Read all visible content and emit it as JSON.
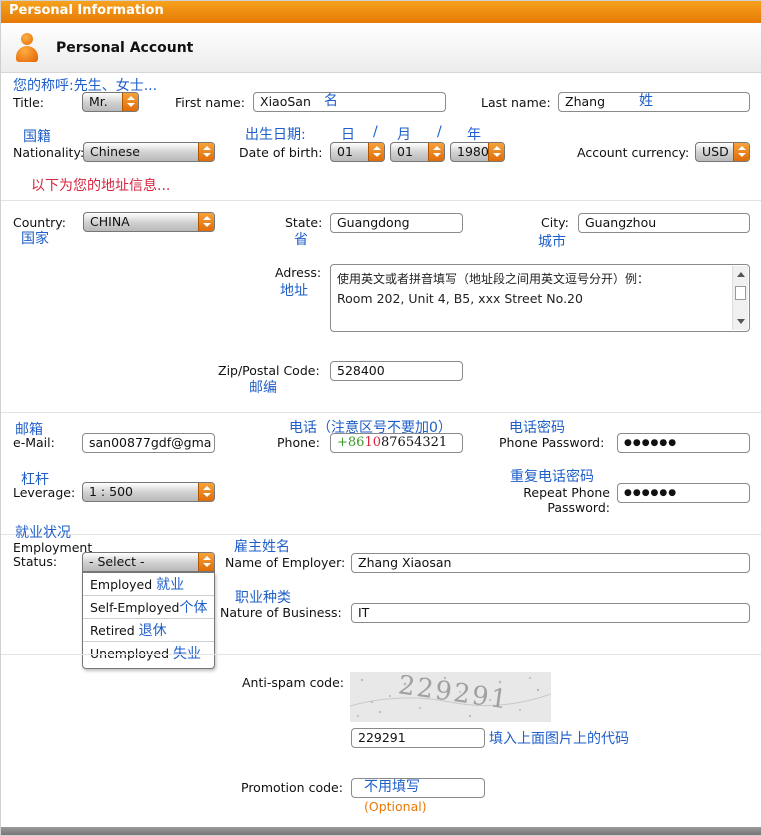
{
  "topbar": {
    "title": "Personal Information"
  },
  "header": {
    "title": "Personal Account",
    "icon": "person-icon"
  },
  "annotations": {
    "salutation": "您的称呼:先生、女士...",
    "first_name_cn": "名",
    "last_name_cn": "姓",
    "nationality_cn": "国籍",
    "dob_cn": "出生日期:",
    "dob_day": "日",
    "dob_month": "月",
    "dob_year": "年",
    "dob_slash1": "/",
    "dob_slash2": "/",
    "address_info": "以下为您的地址信息...",
    "country_cn": "国家",
    "state_cn": "省",
    "city_cn": "城市",
    "address_cn": "地址",
    "zip_cn": "邮编",
    "email_cn": "邮箱",
    "phone_cn": "电话（注意区号不要加0）",
    "phone_pw_cn": "电话密码",
    "leverage_cn": "杠杆",
    "repeat_pw_cn": "重复电话密码",
    "employment_cn": "就业状况",
    "employer_cn": "雇主姓名",
    "business_cn": "职业种类",
    "captcha_cn": "填入上面图片上的代码",
    "promo_cn": "不用填写"
  },
  "form": {
    "title_label": "Title:",
    "title_value": "Mr.",
    "first_name_label": "First name:",
    "first_name_value": "XiaoSan",
    "last_name_label": "Last name:",
    "last_name_value": "Zhang",
    "nationality_label": "Nationality:",
    "nationality_value": "Chinese",
    "dob_label": "Date of birth:",
    "dob_day_value": "01",
    "dob_month_value": "01",
    "dob_year_value": "1980",
    "currency_label": "Account currency:",
    "currency_value": "USD",
    "country_label": "Country:",
    "country_value": "CHINA",
    "state_label": "State:",
    "state_value": "Guangdong",
    "city_label": "City:",
    "city_value": "Guangzhou",
    "address_label": "Adress:",
    "address_hint": "使用英文或者拼音填写（地址段之间用英文逗号分开）例：",
    "address_value": "Room 202, Unit 4, B5, xxx Street No.20",
    "zip_label": "Zip/Postal Code:",
    "zip_value": "528400",
    "email_label": "e-Mail:",
    "email_value": "san00877gdf@gma",
    "phone_label": "Phone:",
    "phone_prefix_plus": "+",
    "phone_prefix_86": "86",
    "phone_prefix_10": "10",
    "phone_number": "87654321",
    "phone_pw_label": "Phone Password:",
    "phone_pw_value": "●●●●●●",
    "leverage_label": "Leverage:",
    "leverage_value": "1 : 500",
    "repeat_pw_label_1": "Repeat Phone",
    "repeat_pw_label_2": "Password:",
    "repeat_pw_value": "●●●●●●",
    "employment_label_1": "Employment",
    "employment_label_2": "Status:",
    "employment_value": "- Select -",
    "employment_options": [
      {
        "en": "Employed",
        "cn": "就业"
      },
      {
        "en": "Self-Employed",
        "cn": "个体"
      },
      {
        "en": "Retired",
        "cn": "退休"
      },
      {
        "en": "Unemployed",
        "cn": "失业"
      }
    ],
    "employer_label": "Name of Employer:",
    "employer_value": "Zhang Xiaosan",
    "business_label": "Nature of Business:",
    "business_value": "IT",
    "antispam_label": "Anti-spam code:",
    "captcha_image_text": "229291",
    "captcha_value": "229291",
    "promo_label": "Promotion code:",
    "promo_optional": "(Optional)"
  },
  "colors": {
    "accent": "#e67a06",
    "annotation_blue": "#1f5fc9",
    "annotation_red": "#d8263f"
  }
}
